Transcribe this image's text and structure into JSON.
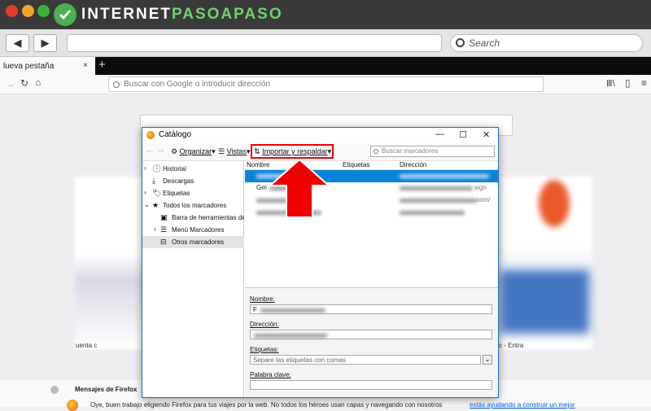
{
  "outer": {
    "logo": {
      "part1": "INTERNET",
      "part2": "PASOAPASO"
    },
    "search_placeholder": "Search",
    "back_glyph": "◀",
    "forward_glyph": "▶"
  },
  "firefox": {
    "tab_label": "lueva pestaña",
    "tab_close": "×",
    "new_tab": "+",
    "url_placeholder": "Buscar con Google o introducir dirección",
    "icons": [
      "back-arrow-icon",
      "reload-icon",
      "home-icon",
      "library-icon",
      "sidebar-icon",
      "menu-icon"
    ]
  },
  "page": {
    "messages_title": "Mensajes de Firefox",
    "messages_text": "Oye, buen trabajo eligiendo Firefox para tus viajes por la web. No todos los héroes usan capas y navegando con nosotros",
    "messages_link": "estás ayudando a construir un mejor",
    "tile_left_fragment": "uenta c",
    "tile_right_fragment": "c - Entra"
  },
  "library": {
    "title": "Catálogo",
    "window_controls": {
      "minimize": "—",
      "maximize": "☐",
      "close": "✕"
    },
    "toolbar": {
      "back": "←",
      "forward": "→",
      "organize": "Organizar",
      "views": "Vistas",
      "import_backup": "Importar y respaldar",
      "search_placeholder": "Buscar marcadores"
    },
    "sidebar": [
      {
        "label": "Historial",
        "arrow": "›",
        "icon": "history-icon"
      },
      {
        "label": "Descargas",
        "arrow": "",
        "icon": "download-icon"
      },
      {
        "label": "Etiquetas",
        "arrow": "›",
        "icon": "tag-icon"
      },
      {
        "label": "Todos los marcadores",
        "arrow": "⌄",
        "icon": "star-icon"
      },
      {
        "label": "Barra de herramientas de...",
        "arrow": "",
        "icon": "toolbar-folder-icon"
      },
      {
        "label": "Menú Marcadores",
        "arrow": "›",
        "icon": "menu-folder-icon"
      },
      {
        "label": "Otros marcadores",
        "arrow": "",
        "icon": "other-folder-icon"
      }
    ],
    "columns": {
      "name": "Nombre",
      "tags": "Etiquetas",
      "address": "Dirección"
    },
    "rows": [
      {
        "name": "",
        "url": ""
      },
      {
        "name": "Gm",
        "url": "sign"
      },
      {
        "name": "",
        "url": "com/"
      },
      {
        "name": "",
        "url": ""
      }
    ],
    "details": {
      "name_label": "Nombre:",
      "name_value": "F",
      "address_label": "Dirección:",
      "tags_label": "Etiquetas:",
      "tags_placeholder": "Separe las etiquetas con comas",
      "keyword_label": "Palabra clave:"
    }
  },
  "colors": {
    "highlight": "#0a84d6",
    "callout": "#e00000"
  }
}
